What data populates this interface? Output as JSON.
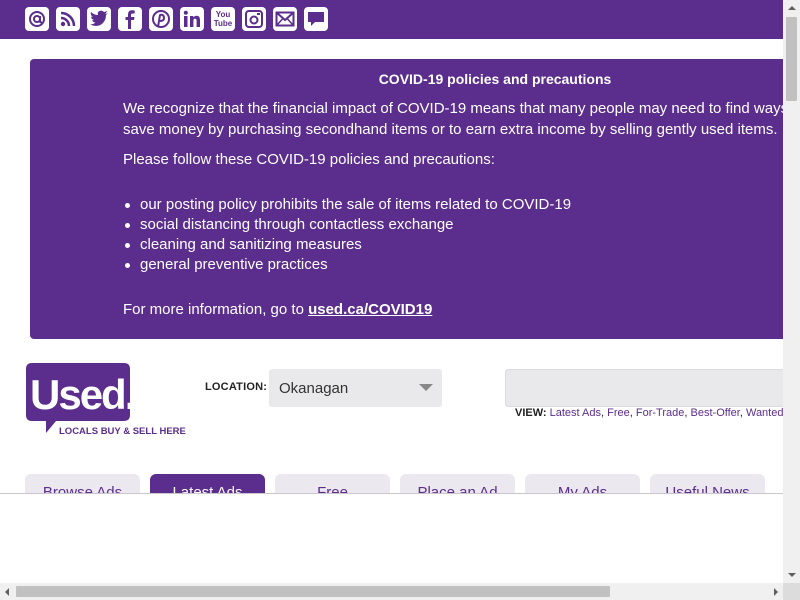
{
  "social": {
    "icons": [
      "at-icon",
      "rss-icon",
      "twitter-icon",
      "facebook-icon",
      "pinterest-icon",
      "linkedin-icon",
      "youtube-icon",
      "instagram-icon",
      "email-icon",
      "chat-icon"
    ],
    "youtube_text": "You Tube"
  },
  "notice": {
    "title": "COVID-19 policies and precautions",
    "p1_line1": "We recognize that the financial impact of COVID-19 means that many people may need to find ways to",
    "p1_line2": "save money by purchasing secondhand items or to earn extra income by selling gently used items.",
    "p2": "Please follow these COVID-19 policies and precautions:",
    "bullets": [
      "our posting policy prohibits the sale of items related to COVID-19",
      "social distancing through contactless exchange",
      "cleaning and sanitizing measures",
      "general preventive practices"
    ],
    "more_prefix": "For more information, go to ",
    "more_link": "used.ca/COVID19"
  },
  "logo": {
    "brand": "Used.ca",
    "tagline": "LOCALS BUY & SELL HERE"
  },
  "location": {
    "label": "LOCATION:",
    "value": "Okanagan"
  },
  "view": {
    "label": "VIEW:",
    "links": [
      "Latest Ads",
      "Free",
      "For-Trade",
      "Best-Offer",
      "Wanted"
    ]
  },
  "tabs": [
    {
      "label": "Browse Ads",
      "active": false
    },
    {
      "label": "Latest Ads",
      "active": true
    },
    {
      "label": "Free",
      "active": false
    },
    {
      "label": "Place an Ad",
      "active": false
    },
    {
      "label": "My Ads",
      "active": false
    },
    {
      "label": "Useful News",
      "active": false
    }
  ],
  "colors": {
    "brand_purple": "#5b2d8c",
    "tab_inactive_bg": "#ebe9ef",
    "field_bg": "#e9e9eb"
  }
}
